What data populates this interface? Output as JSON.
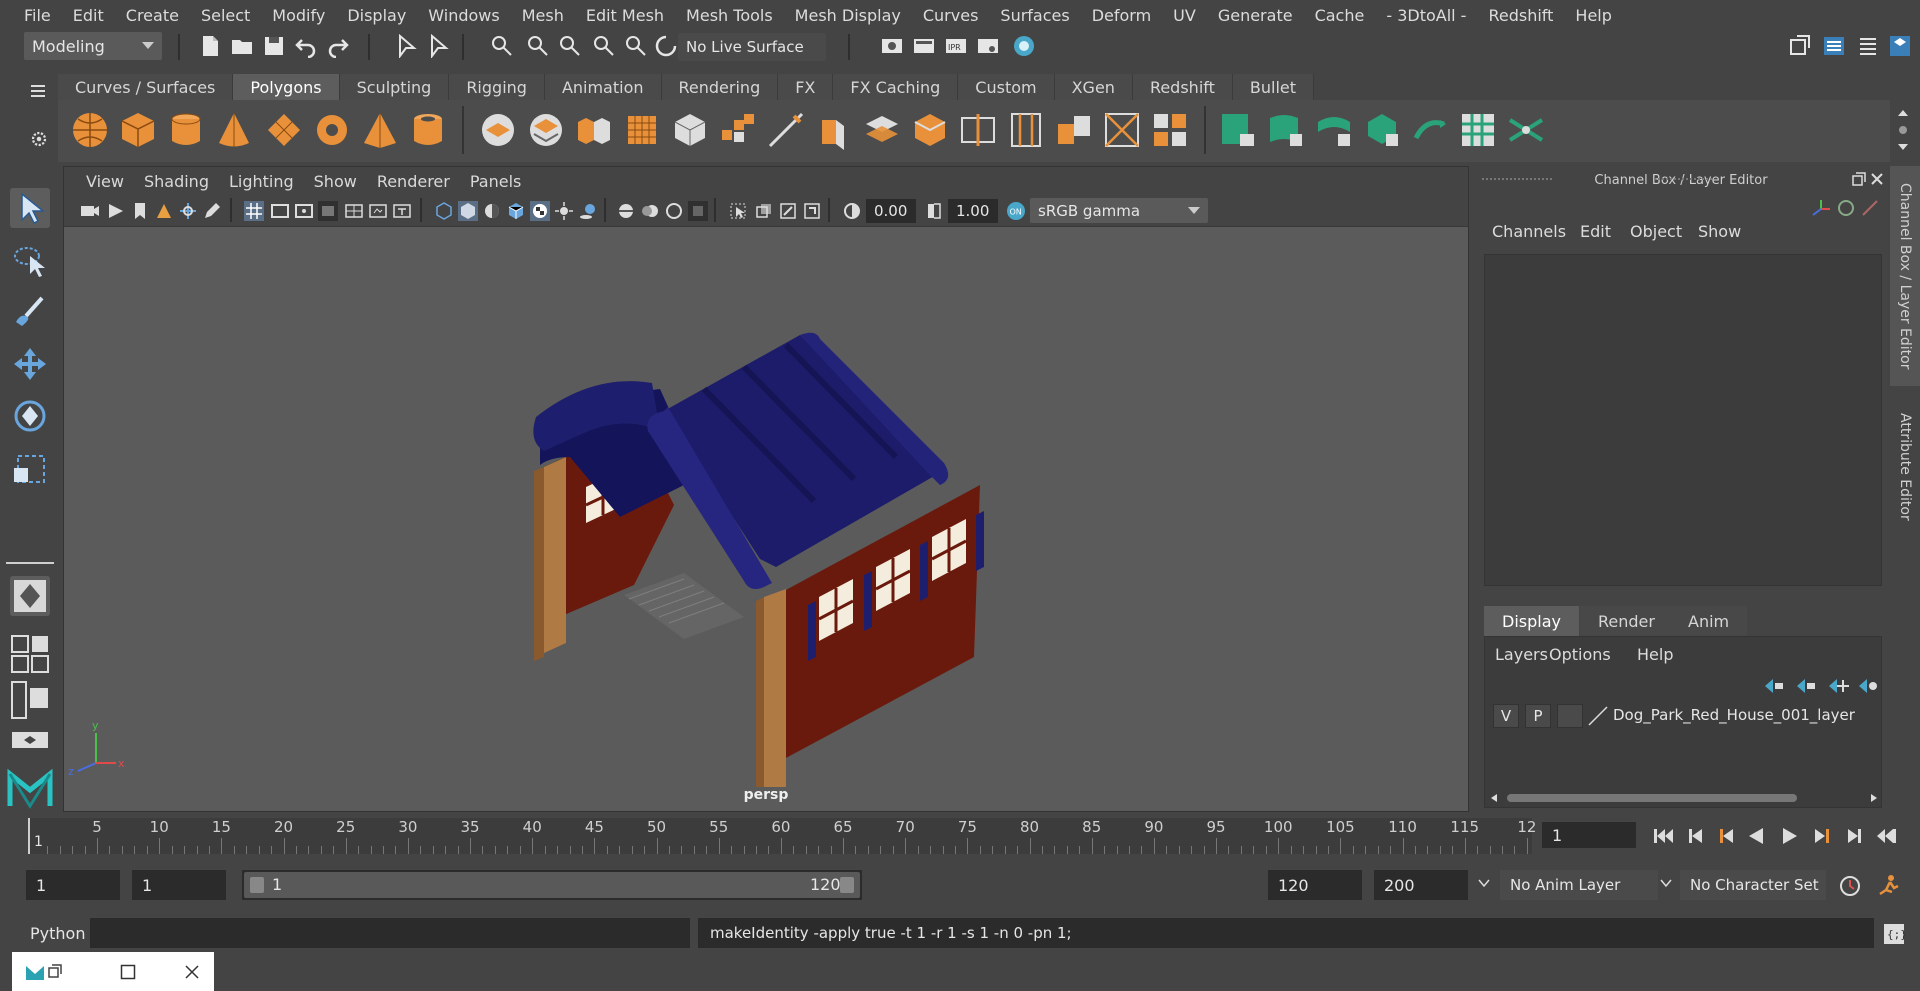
{
  "menubar": {
    "items": [
      "File",
      "Edit",
      "Create",
      "Select",
      "Modify",
      "Display",
      "Windows",
      "Mesh",
      "Edit Mesh",
      "Mesh Tools",
      "Mesh Display",
      "Curves",
      "Surfaces",
      "Deform",
      "UV",
      "Generate",
      "Cache",
      "- 3DtoAll -",
      "Redshift",
      "Help"
    ]
  },
  "statusline": {
    "mode": "Modeling",
    "live_surface": "No Live Surface"
  },
  "shelf": {
    "tabs": [
      "Curves / Surfaces",
      "Polygons",
      "Sculpting",
      "Rigging",
      "Animation",
      "Rendering",
      "FX",
      "FX Caching",
      "Custom",
      "XGen",
      "Redshift",
      "Bullet"
    ],
    "active_tab": "Polygons"
  },
  "viewport": {
    "menu": [
      "View",
      "Shading",
      "Lighting",
      "Show",
      "Renderer",
      "Panels"
    ],
    "exposure": "0.00",
    "gamma": "1.00",
    "colorspace": "sRGB gamma",
    "camera": "persp"
  },
  "channelbox": {
    "title": "Channel Box / Layer Editor",
    "menu": [
      "Channels",
      "Edit",
      "Object",
      "Show"
    ],
    "layer_tabs": [
      "Display",
      "Render",
      "Anim"
    ],
    "active_layer_tab": "Display",
    "layer_menu": [
      "Layers",
      "Options",
      "Help"
    ],
    "layer": {
      "v": "V",
      "p": "P",
      "name": "Dog_Park_Red_House_001_layer"
    }
  },
  "sidetabs": {
    "channel": "Channel Box / Layer Editor",
    "attribute": "Attribute Editor"
  },
  "timeslider": {
    "ticks": [
      "5",
      "10",
      "15",
      "20",
      "25",
      "30",
      "35",
      "40",
      "45",
      "50",
      "55",
      "60",
      "65",
      "70",
      "75",
      "80",
      "85",
      "90",
      "95",
      "100",
      "105",
      "110",
      "115",
      "12"
    ],
    "start_marker": "1",
    "current_frame": "1"
  },
  "range": {
    "start": "1",
    "playback_start": "1",
    "slider_start": "1",
    "slider_end": "120",
    "playback_end": "120",
    "end": "200",
    "anim_layer": "No Anim Layer",
    "character_set": "No Character Set"
  },
  "cmdline": {
    "label": "Python",
    "result": "makeIdentity -apply true -t 1 -r 1 -s 1 -n 0 -pn 1;"
  },
  "colors": {
    "roof": "#1e1e6e",
    "wall": "#6a1a0d",
    "post": "#b07a45",
    "accent_green": "#2aa27a"
  }
}
